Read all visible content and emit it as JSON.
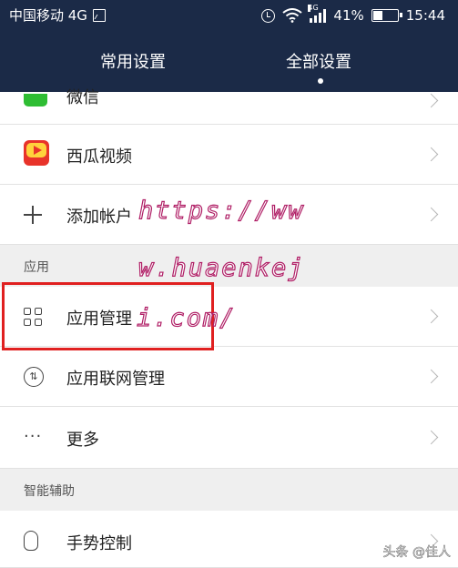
{
  "status_bar": {
    "carrier": "中国移动 4G",
    "network_tag": "4G",
    "battery_text": "41%",
    "battery_level": 0.41,
    "time": "15:44"
  },
  "tabs": [
    {
      "label": "常用设置",
      "selected": false
    },
    {
      "label": "全部设置",
      "selected": true
    }
  ],
  "rows": {
    "wechat": {
      "label": "微信",
      "icon": "wechat-icon"
    },
    "xigua": {
      "label": "西瓜视频",
      "icon": "xigua-video-icon"
    },
    "add_account": {
      "label": "添加帐户",
      "icon": "plus-icon"
    },
    "app_mgmt": {
      "label": "应用管理",
      "icon": "apps-grid-icon"
    },
    "net_mgmt": {
      "label": "应用联网管理",
      "icon": "network-icon"
    },
    "more": {
      "label": "更多",
      "icon": "more-icon"
    },
    "gesture": {
      "label": "手势控制",
      "icon": "hand-icon"
    }
  },
  "sections": {
    "apps": "应用",
    "assist": "智能辅助"
  },
  "watermark": {
    "line1": "https://ww",
    "line2": "w.huaenkej",
    "line3": "i.com/",
    "footer": "头条 @佳人"
  },
  "colors": {
    "header": "#1b2a47",
    "highlight_box": "#e02020",
    "watermark_stroke": "#b01f66"
  }
}
